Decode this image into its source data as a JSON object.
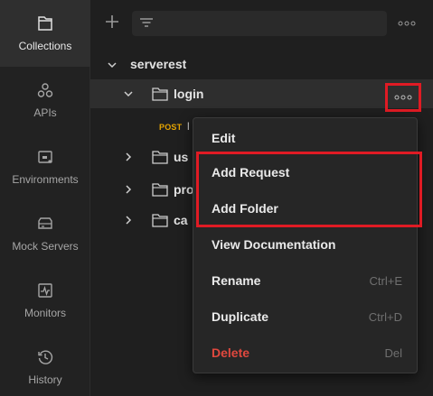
{
  "rail": {
    "items": [
      {
        "label": "Collections",
        "icon": "collections-icon",
        "active": true
      },
      {
        "label": "APIs",
        "icon": "apis-icon"
      },
      {
        "label": "Environments",
        "icon": "environments-icon"
      },
      {
        "label": "Mock Servers",
        "icon": "mock-servers-icon"
      },
      {
        "label": "Monitors",
        "icon": "monitors-icon"
      },
      {
        "label": "History",
        "icon": "history-icon"
      }
    ]
  },
  "sidebar": {
    "collection_name": "serverest",
    "folders": [
      {
        "name": "login",
        "expanded": true
      },
      {
        "name": "us"
      },
      {
        "name": "pro"
      },
      {
        "name": "ca"
      }
    ],
    "request": {
      "method": "POST",
      "name": "l"
    }
  },
  "menu": {
    "items": [
      {
        "label": "Edit",
        "shortcut": ""
      },
      {
        "label": "Add Request",
        "shortcut": ""
      },
      {
        "label": "Add Folder",
        "shortcut": ""
      },
      {
        "label": "View Documentation",
        "shortcut": ""
      },
      {
        "label": "Rename",
        "shortcut": "Ctrl+E"
      },
      {
        "label": "Duplicate",
        "shortcut": "Ctrl+D"
      },
      {
        "label": "Delete",
        "shortcut": "Del"
      }
    ]
  },
  "colors": {
    "background": "#1f1f1f",
    "rail": "#222222",
    "highlight_box": "#e01b24",
    "post": "#e6a400",
    "delete": "#e0483e"
  }
}
